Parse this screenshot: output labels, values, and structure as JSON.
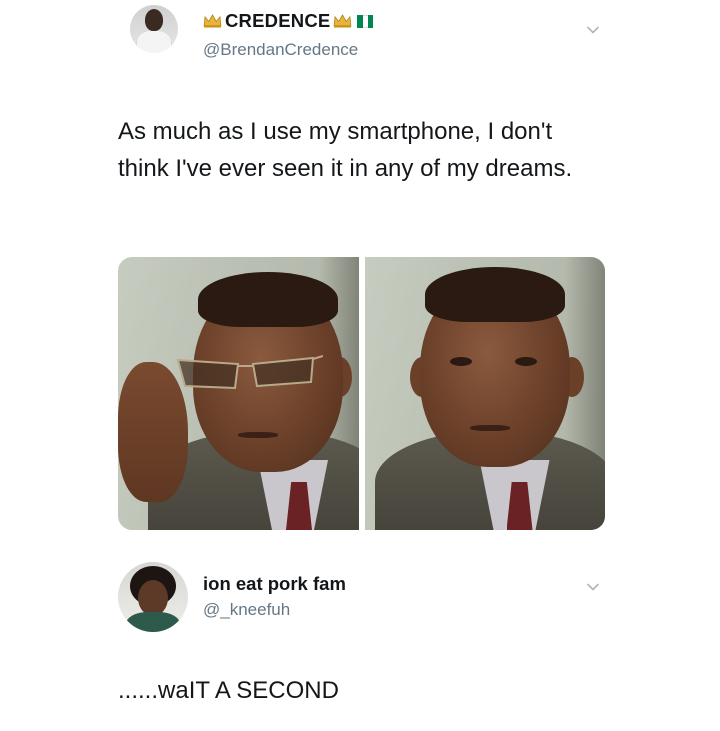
{
  "tweet": {
    "display_name": "CREDENCE",
    "handle": "@BrendanCredence",
    "text": "As much as I use my smartphone, I don't think I've ever seen it in any of my dreams.",
    "name_icons": [
      "crown-icon",
      "crown-icon",
      "nigeria-flag-icon"
    ],
    "media": [
      "man-with-glasses-photo",
      "man-without-glasses-photo"
    ]
  },
  "reply": {
    "display_name": "ion eat pork fam",
    "handle": "@_kneefuh",
    "text": "......waIT A SECOND"
  },
  "colors": {
    "text": "#14171a",
    "secondary_text": "#657786",
    "chevron": "#aab8c2",
    "crown": "#e8b43a",
    "flag_green": "#008751"
  }
}
